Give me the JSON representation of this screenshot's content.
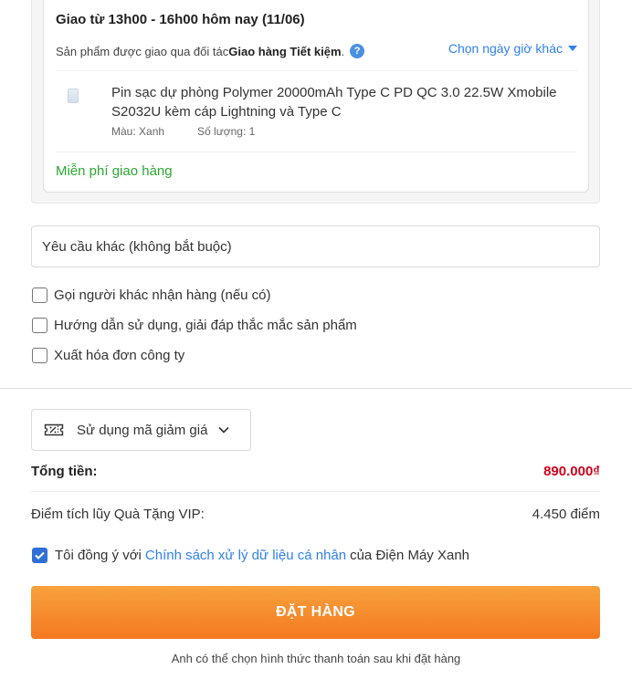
{
  "delivery": {
    "title": "Giao từ 13h00 - 16h00 hôm nay (11/06)",
    "partner_prefix": "Sản phẩm được giao qua đối tác ",
    "partner_name": "Giao hàng Tiết kiệm",
    "partner_suffix": ".",
    "help_glyph": "?",
    "choose_time_label": "Chọn ngày giờ khác",
    "product": {
      "name": "Pin sạc dự phòng Polymer 20000mAh Type C PD QC 3.0 22.5W Xmobile S2032U kèm cáp Lightning và Type C",
      "color": "Màu: Xanh",
      "quantity": "Số lượng: 1"
    },
    "shipping_fee": "Miễn phí giao hàng"
  },
  "request": {
    "placeholder": "Yêu cầu khác (không bắt buộc)"
  },
  "options": [
    {
      "label": "Gọi người khác nhận hàng (nếu có)",
      "checked": false
    },
    {
      "label": "Hướng dẫn sử dụng, giải đáp thắc mắc sản phẩm",
      "checked": false
    },
    {
      "label": "Xuất hóa đơn công ty",
      "checked": false
    }
  ],
  "coupon": {
    "label": "Sử dụng mã giảm giá",
    "icon": "coupon-ticket-icon"
  },
  "summary": {
    "total_label": "Tổng tiền:",
    "total_value": "890.000₫",
    "vip_label": "Điểm tích lũy Quà Tặng VIP:",
    "vip_value": "4.450 điểm"
  },
  "agreement": {
    "checked": true,
    "prefix": "Tôi đồng ý với",
    "link": "Chính sách xử lý dữ liệu cá nhân",
    "suffix": "của Điện Máy Xanh"
  },
  "order": {
    "button_label": "ĐẶT HÀNG",
    "note": "Anh có thể chọn hình thức thanh toán sau khi đặt hàng"
  },
  "colors": {
    "accent_blue": "#2f80ed",
    "price_red": "#d0021b",
    "free_green": "#2ba832",
    "order_orange": "#f47920"
  }
}
